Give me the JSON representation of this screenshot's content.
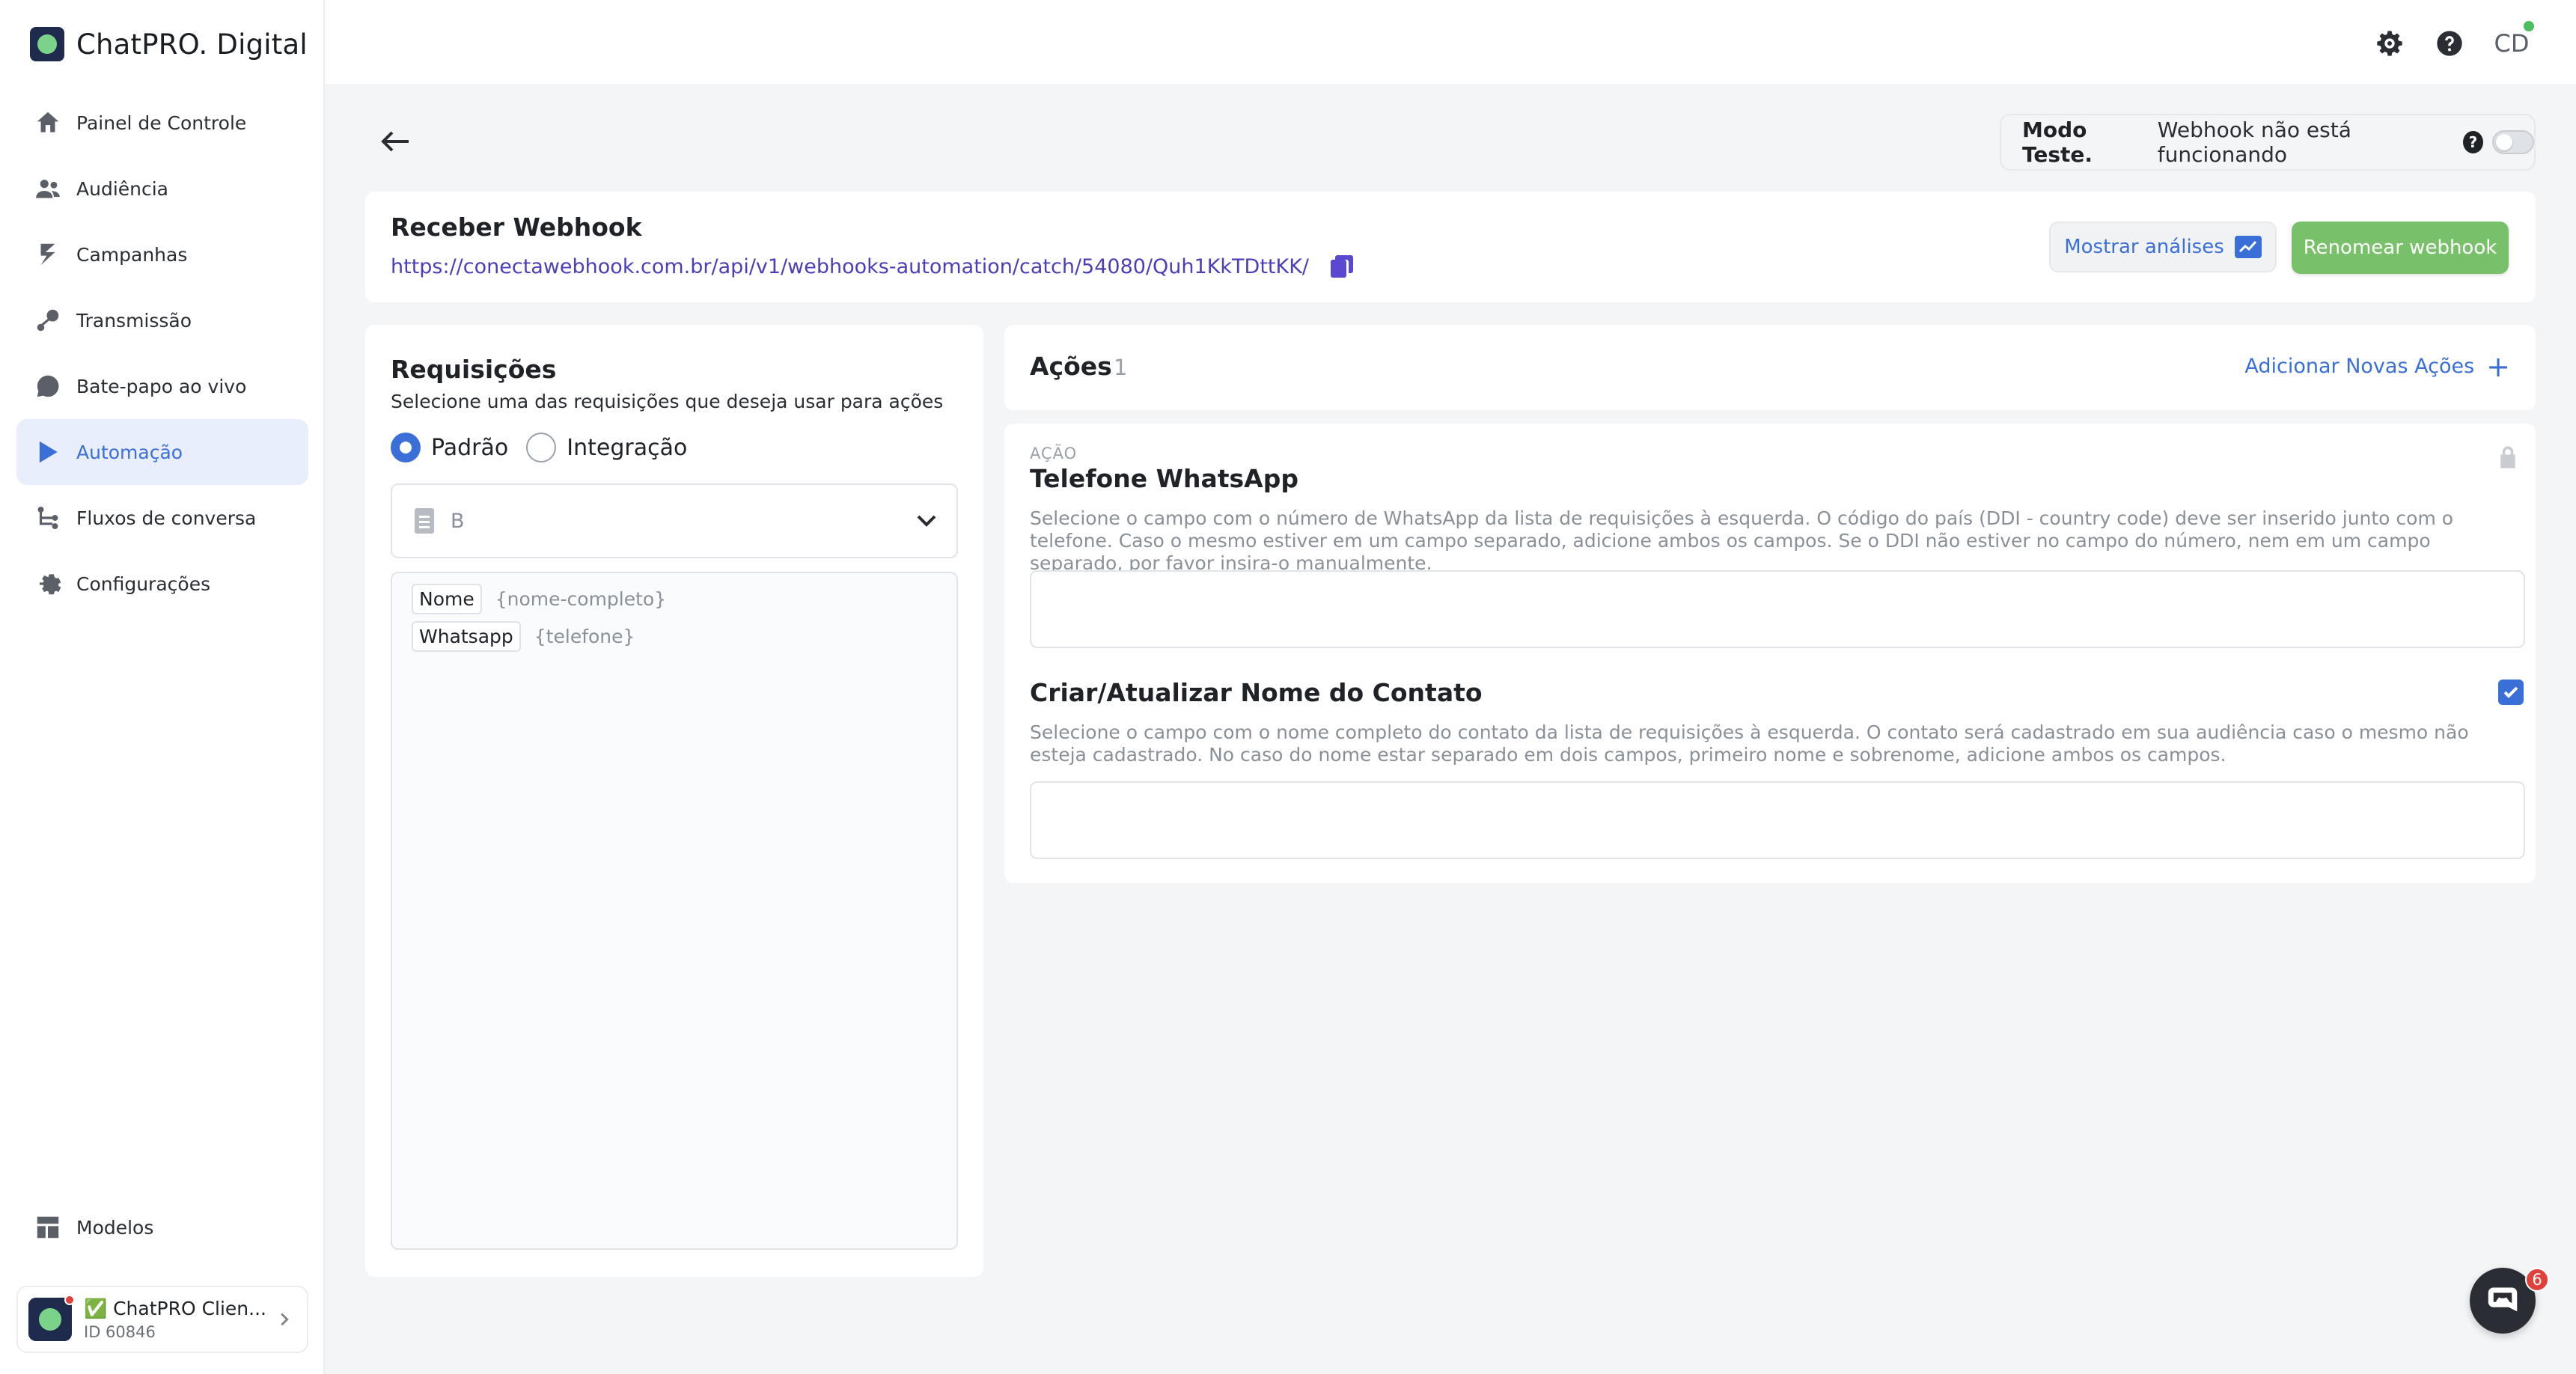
{
  "app": {
    "brand_name": "ChatPRO. Digital"
  },
  "sidebar": {
    "items": [
      {
        "label": "Painel de Controle",
        "icon": "home-icon"
      },
      {
        "label": "Audiência",
        "icon": "users-icon"
      },
      {
        "label": "Campanhas",
        "icon": "bolt-icon"
      },
      {
        "label": "Transmissão",
        "icon": "broadcast-icon"
      },
      {
        "label": "Bate-papo ao vivo",
        "icon": "chat-bubble-icon"
      },
      {
        "label": "Automação",
        "icon": "play-icon",
        "active": true
      },
      {
        "label": "Fluxos de conversa",
        "icon": "flow-icon"
      },
      {
        "label": "Configurações",
        "icon": "gear-icon"
      }
    ],
    "bottom_item": {
      "label": "Modelos",
      "icon": "templates-icon"
    },
    "account": {
      "name": "✅ ChatPRO Clien...",
      "id": "ID 60846"
    }
  },
  "topbar": {
    "avatar_initials": "CD"
  },
  "test_mode": {
    "label": "Modo Teste.",
    "message": "Webhook não está funcionando",
    "help_icon": "?",
    "enabled": false
  },
  "webhook": {
    "title": "Receber Webhook",
    "url": "https://conectawebhook.com.br/api/v1/webhooks-automation/catch/54080/Quh1KkTDttKK/",
    "analytics_button": "Mostrar análises",
    "rename_button": "Renomear webhook"
  },
  "requests": {
    "title": "Requisições",
    "subtitle": "Selecione uma das requisições que deseja usar para ações",
    "radio_options": [
      {
        "label": "Padrão",
        "checked": true
      },
      {
        "label": "Integração",
        "checked": false
      }
    ],
    "selected_request": "B",
    "fields": [
      {
        "key": "Nome",
        "value": "{nome-completo}"
      },
      {
        "key": "Whatsapp",
        "value": "{telefone}"
      }
    ]
  },
  "actions": {
    "title": "Ações",
    "count": "1",
    "add_label": "Adicionar Novas Ações",
    "add_plus": "+",
    "card": {
      "kind_label": "AÇÃO",
      "phone_title": "Telefone WhatsApp",
      "phone_desc": "Selecione o campo com o número de WhatsApp da lista de requisições à esquerda. O código do país (DDI - country code) deve ser inserido junto com o telefone. Caso o mesmo estiver em um campo separado, adicione ambos os campos. Se o DDI não estiver no campo do número, nem em um campo separado, por favor insira-o manualmente.",
      "name_title": "Criar/Atualizar Nome do Contato",
      "name_checked": true,
      "name_desc": "Selecione o campo com o nome completo do contato da lista de requisições à esquerda. O contato será cadastrado em sua audiência caso o mesmo não esteja cadastrado. No caso do nome estar separado em dois campos, primeiro nome e sobrenome, adicione ambos os campos."
    }
  },
  "chat_widget": {
    "badge": "6"
  },
  "colors": {
    "accent": "#3b6fd8",
    "success": "#78c16a",
    "link": "#4a3fb8"
  }
}
